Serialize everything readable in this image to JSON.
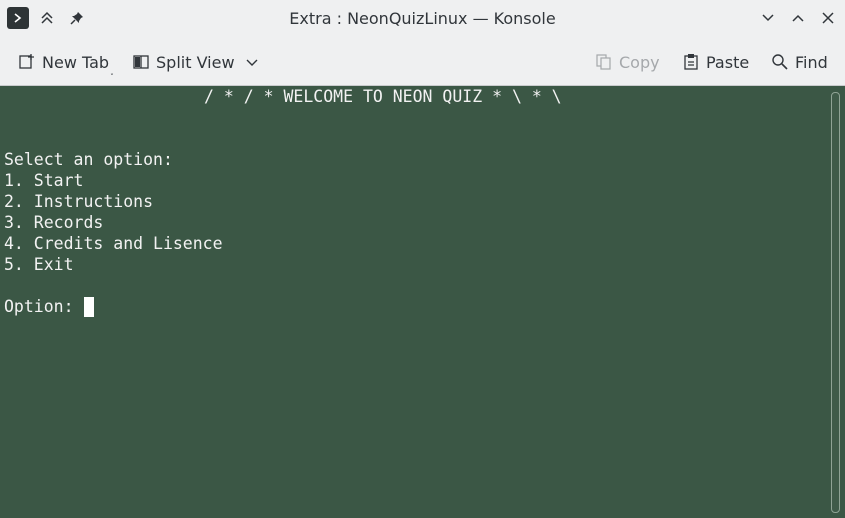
{
  "window": {
    "title": "Extra : NeonQuizLinux — Konsole"
  },
  "titlebar": {
    "icons": [
      "konsole-app-icon",
      "keep-above-icon",
      "pin-icon",
      "minimize-icon",
      "maximize-icon",
      "close-icon"
    ]
  },
  "toolbar": {
    "new_tab_label": "New Tab",
    "split_view_label": "Split View",
    "copy_label": "Copy",
    "paste_label": "Paste",
    "find_label": "Find"
  },
  "terminal": {
    "colors": {
      "background": "#3b5745",
      "foreground": "#f2f2f2"
    },
    "banner": "/ * / * WELCOME TO NEON QUIZ * \\ * \\",
    "prompt_header": "Select an option:",
    "options": [
      "1. Start",
      "2. Instructions",
      "3. Records",
      "4. Credits and Lisence",
      "5. Exit"
    ],
    "input_prompt": "Option: "
  }
}
